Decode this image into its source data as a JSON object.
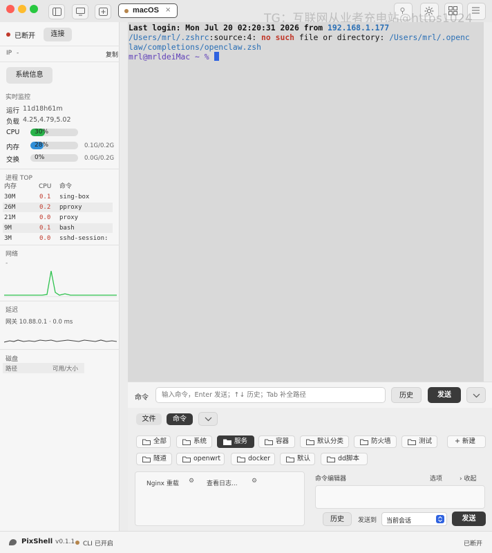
{
  "window": {
    "tab_title": "macOS",
    "tab_close": "×",
    "watermark": "TG：互联网从业者充电站@https1024"
  },
  "sidebar": {
    "status_text": "已断开",
    "connect_label": "连接",
    "ip_label": "IP",
    "ip_value": "-",
    "copy_label": "复制",
    "sysinfo_label": "系统信息",
    "monitor": {
      "title": "实时监控",
      "uptime_label": "运行",
      "uptime_value": "11d18h61m",
      "load_label": "负载",
      "load_value": "4.25,4.79,5.02",
      "cpu_label": "CPU",
      "cpu_percent": 30,
      "cpu_text": "30%",
      "mem_label": "内存",
      "mem_percent": 28,
      "mem_text": "28%",
      "mem_detail": "0.1G/0.2G",
      "swap_label": "交换",
      "swap_percent": 0,
      "swap_text": "0%",
      "swap_detail": "0.0G/0.2G"
    },
    "process": {
      "title": "进程 TOP",
      "headers": [
        "内存",
        "CPU",
        "命令"
      ],
      "rows": [
        {
          "mem": "30M",
          "cpu": "0.1",
          "cmd": "sing-box"
        },
        {
          "mem": "26M",
          "cpu": "0.2",
          "cmd": "pproxy"
        },
        {
          "mem": "21M",
          "cpu": "0.0",
          "cmd": "proxy"
        },
        {
          "mem": "9M",
          "cpu": "0.1",
          "cmd": "bash"
        },
        {
          "mem": "3M",
          "cpu": "0.0",
          "cmd": "sshd-session:"
        }
      ]
    },
    "network": {
      "title": "网络",
      "value": "-"
    },
    "latency": {
      "title": "延迟",
      "value": "网关 10.88.0.1 · 0.0 ms"
    },
    "disk": {
      "title": "磁盘",
      "col_path": "路径",
      "col_usage": "可用/大小"
    }
  },
  "terminal": {
    "line1_prefix": "Last login: Mon Jul 20 02:20:31 2026 from ",
    "line1_ip": "192.168.1.177",
    "line2_path": "/Users/mrl/.zshrc",
    "line2_source": ":source:4: ",
    "line2_error": "no such",
    "line2_mid": " file or directory: ",
    "line2_target": "/Users/mrl/.openc",
    "line3_target": "law/completions/openclaw.zsh",
    "prompt": "mrl@mrldeiMac ~ % "
  },
  "command_bar": {
    "label": "命令",
    "placeholder": "输入命令，Enter 发送；↑↓ 历史；Tab 补全路径",
    "history_label": "历史",
    "send_label": "发送"
  },
  "panel": {
    "tabs": [
      "文件",
      "命令"
    ],
    "categories": [
      "全部",
      "系统",
      "服务",
      "容器",
      "默认分类",
      "防火墙",
      "测试"
    ],
    "new_label": "+ 新建",
    "categories_row2": [
      "隧道",
      "openwrt",
      "docker",
      "默认",
      "dd脚本"
    ],
    "commands": [
      "Nginx 重载",
      "查看日志..."
    ],
    "editor_title": "命令编辑器",
    "editor_options": "选项",
    "editor_collapse": "收起",
    "editor_history": "历史",
    "send_to_label": "发送到",
    "send_target": "当前会话",
    "editor_send": "发送"
  },
  "statusbar": {
    "app_name": "PixShell",
    "version": "v0.1.1",
    "cli_text": "CLI 已开启",
    "right_status": "已断开"
  },
  "colors": {
    "disconnected": "#c0392b",
    "cpu_bar": "#28b34a",
    "mem_bar": "#2f8fd8",
    "network_line": "#2ec24e",
    "latency_line": "#444444",
    "terminal_bg": "#d9d9d9"
  },
  "icons": [
    "sidebar-toggle-icon",
    "monitor-icon",
    "new-tab-icon",
    "folder-icon",
    "chevron-down-icon",
    "settings-icon",
    "grid-icon",
    "menu-icon",
    "close-icon"
  ]
}
